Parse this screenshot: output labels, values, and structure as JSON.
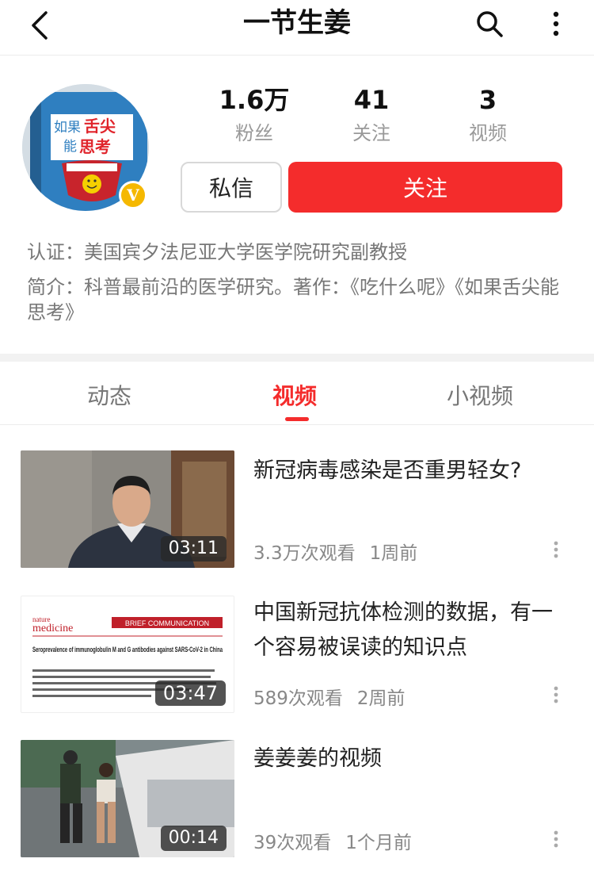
{
  "header": {
    "title": "一节生姜"
  },
  "profile": {
    "avatar_text_a": "如果",
    "avatar_text_b": "舌尖",
    "avatar_text_c": "能",
    "avatar_text_d": "思考",
    "badge": "V",
    "stats": [
      {
        "value": "1.6万",
        "label": "粉丝"
      },
      {
        "value": "41",
        "label": "关注"
      },
      {
        "value": "3",
        "label": "视频"
      }
    ],
    "message_label": "私信",
    "follow_label": "关注",
    "certification": "认证：美国宾夕法尼亚大学医学院研究副教授",
    "intro": "简介：科普最前沿的医学研究。著作：《吃什么呢》《如果舌尖能思考》"
  },
  "tabs": [
    {
      "label": "动态"
    },
    {
      "label": "视频"
    },
    {
      "label": "小视频"
    }
  ],
  "videos": [
    {
      "title": "新冠病毒感染是否重男轻女?",
      "duration": "03:11",
      "views": "3.3万次观看",
      "time": "1周前"
    },
    {
      "title": "中国新冠抗体检测的数据，有一个容易被误读的知识点",
      "duration": "03:47",
      "views": "589次观看",
      "time": "2周前",
      "thumb_journal_a": "nature",
      "thumb_journal_b": "medicine",
      "thumb_banner": "BRIEF COMMUNICATION",
      "thumb_paper_title": "Seroprevalence of immunoglobulin M and G antibodies against SARS-CoV-2 in China"
    },
    {
      "title": "姜姜姜的视频",
      "duration": "00:14",
      "views": "39次观看",
      "time": "1个月前"
    }
  ],
  "colors": {
    "accent": "#f42c2c",
    "badge": "#f5b800"
  }
}
